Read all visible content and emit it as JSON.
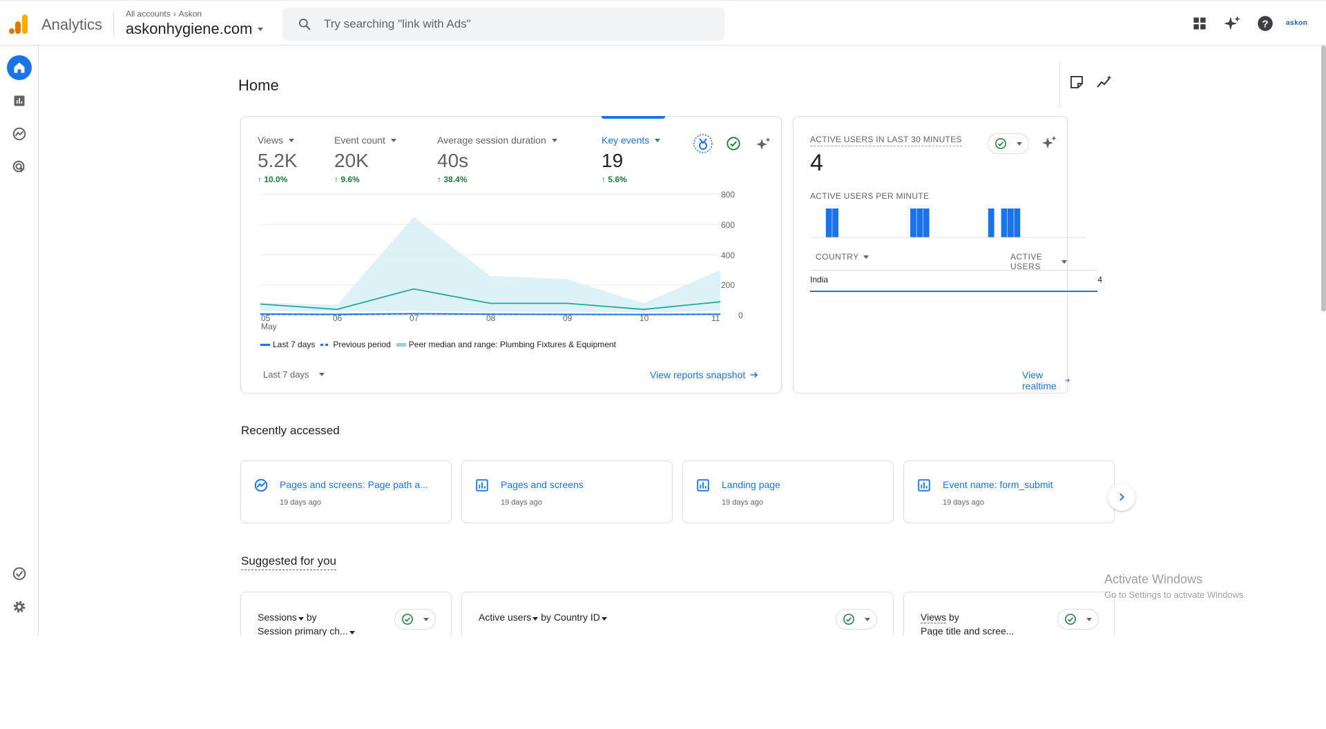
{
  "app": {
    "name": "Analytics",
    "breadcrumb": [
      "All accounts",
      "Askon"
    ],
    "property": "askonhygiene.com",
    "account_label": "askon"
  },
  "search": {
    "placeholder": "Try searching \"link with Ads\""
  },
  "nav": [
    "home-icon",
    "reports-icon",
    "explore-icon",
    "advertising-icon",
    "admin-check-icon",
    "settings-gear-icon"
  ],
  "page": {
    "title": "Home"
  },
  "overview": {
    "metrics": [
      {
        "label": "Views",
        "value": "5.2K",
        "change": "10.0%"
      },
      {
        "label": "Event count",
        "value": "20K",
        "change": "9.6%"
      },
      {
        "label": "Average session duration",
        "value": "40s",
        "change": "38.4%"
      },
      {
        "label": "Key events",
        "value": "19",
        "change": "5.6%"
      }
    ],
    "date_range": "Last 7 days",
    "link": "View reports snapshot",
    "legend": [
      "Last 7 days",
      "Previous period",
      "Peer median and range: Plumbing Fixtures & Equipment"
    ]
  },
  "chart_data": {
    "type": "area",
    "x": [
      "05\nMay",
      "06",
      "07",
      "08",
      "09",
      "10",
      "11"
    ],
    "x_tick_labels": [
      "05",
      "06",
      "07",
      "08",
      "09",
      "10",
      "11"
    ],
    "x_month_label": "May",
    "y_tick_labels": [
      "800",
      "600",
      "400",
      "200",
      "0"
    ],
    "ylim": [
      0,
      800
    ],
    "series": [
      {
        "name": "Last 7 days",
        "values": [
          10,
          8,
          12,
          9,
          8,
          7,
          9
        ]
      },
      {
        "name": "Previous period",
        "values": [
          8,
          6,
          10,
          8,
          7,
          6,
          8
        ]
      },
      {
        "name": "Peer median and range: Plumbing Fixtures & Equipment",
        "values": [
          75,
          40,
          175,
          80,
          80,
          40,
          90
        ],
        "range_low": [
          30,
          25,
          30,
          25,
          25,
          20,
          30
        ],
        "range_high": [
          85,
          70,
          650,
          260,
          240,
          80,
          300
        ]
      }
    ],
    "grid": true
  },
  "realtime": {
    "title": "ACTIVE USERS IN LAST 30 MINUTES",
    "value": "4",
    "per_minute_label": "ACTIVE USERS PER MINUTE",
    "per_minute": [
      0,
      0,
      1,
      1,
      0,
      0,
      0,
      0,
      0,
      0,
      0,
      0,
      0,
      0,
      0,
      1,
      1,
      1,
      0,
      0,
      0,
      0,
      0,
      0,
      0,
      0,
      0,
      1,
      0,
      1,
      1,
      1,
      0,
      0,
      0,
      0
    ],
    "table": {
      "col1": "COUNTRY",
      "col2": "ACTIVE USERS",
      "rows": [
        {
          "country": "India",
          "users": "4"
        }
      ]
    },
    "link": "View realtime"
  },
  "recent": {
    "title": "Recently accessed",
    "items": [
      {
        "title": "Pages and screens: Page path a...",
        "time": "19 days ago",
        "icon": "explore-icon"
      },
      {
        "title": "Pages and screens",
        "time": "19 days ago",
        "icon": "report-icon"
      },
      {
        "title": "Landing page",
        "time": "19 days ago",
        "icon": "report-icon"
      },
      {
        "title": "Event name: form_submit",
        "time": "19 days ago",
        "icon": "report-icon"
      }
    ]
  },
  "suggested": {
    "title": "Suggested for you",
    "cards": [
      {
        "metric": "Sessions",
        "by": "by",
        "dim": "Session primary ch..."
      },
      {
        "metric": "Active users",
        "by": "by",
        "dim": "Country ID"
      },
      {
        "metric": "Views",
        "by": "by",
        "dim": "Page title and scree..."
      }
    ]
  },
  "watermark": {
    "line1": "Activate Windows",
    "line2": "Go to Settings to activate Windows."
  },
  "colors": {
    "accent": "#1a73e8",
    "positive": "#188038",
    "peer": "#d6f0f5",
    "peer_line": "#26a69a"
  }
}
